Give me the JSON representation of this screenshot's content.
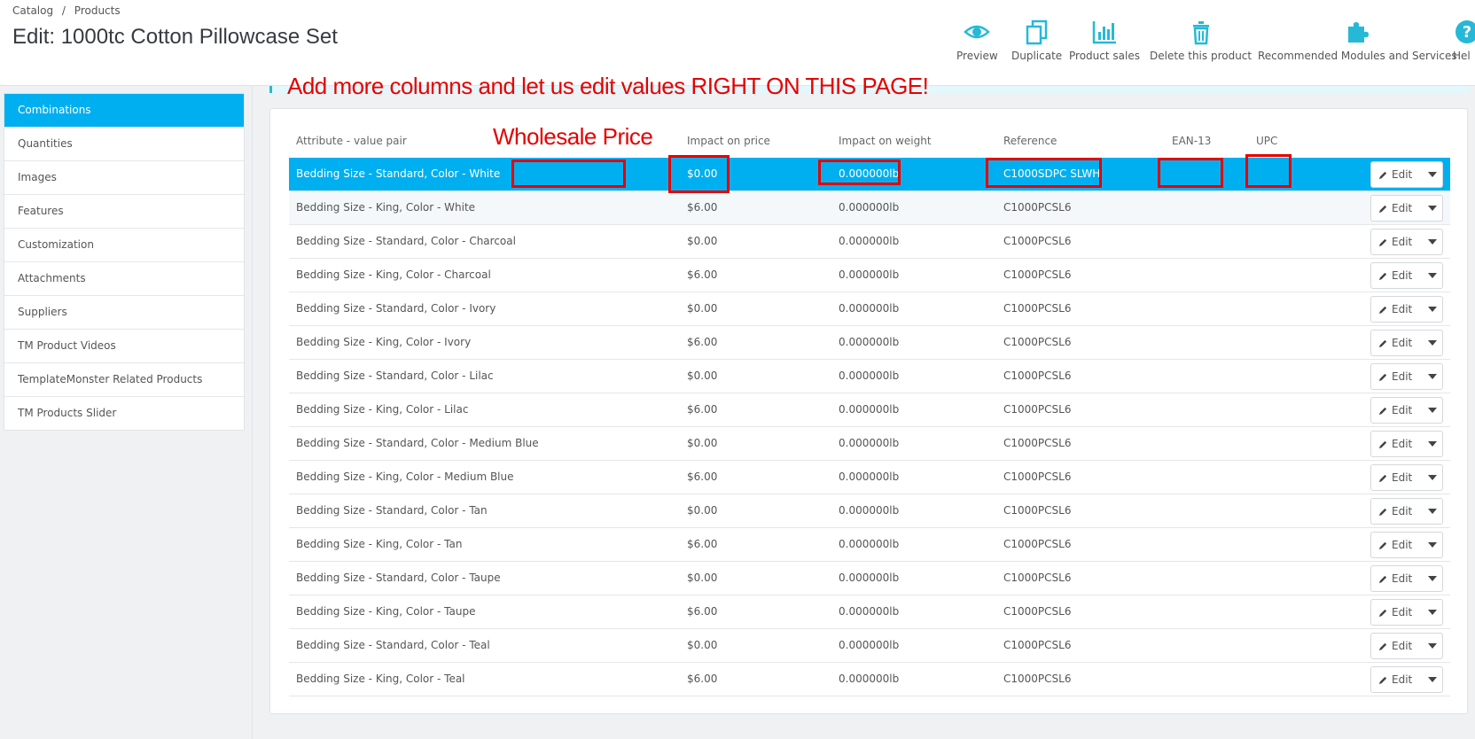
{
  "breadcrumb": [
    "Catalog",
    "/",
    "Products"
  ],
  "page_title": "Edit: 1000tc Cotton Pillowcase Set",
  "toolbar": {
    "preview": "Preview",
    "duplicate": "Duplicate",
    "product_sales": "Product sales",
    "delete": "Delete this product",
    "recommended": "Recommended Modules and Services",
    "help": "Hel"
  },
  "colors": {
    "accent": "#00aff0",
    "annotation": "#e60000"
  },
  "sidebar": {
    "items": [
      {
        "label": "Combinations"
      },
      {
        "label": "Quantities"
      },
      {
        "label": "Images"
      },
      {
        "label": "Features"
      },
      {
        "label": "Customization"
      },
      {
        "label": "Attachments"
      },
      {
        "label": "Suppliers"
      },
      {
        "label": "TM Product Videos"
      },
      {
        "label": "TemplateMonster Related Products"
      },
      {
        "label": "TM Products Slider"
      }
    ]
  },
  "annotations": {
    "top": "Add more columns and let us edit values RIGHT ON THIS PAGE!",
    "wholesale": "Wholesale Price"
  },
  "table": {
    "headers": {
      "attribute": "Attribute - value pair",
      "impact_price": "Impact on price",
      "impact_weight": "Impact on weight",
      "reference": "Reference",
      "ean": "EAN-13",
      "upc": "UPC"
    },
    "edit_label": "Edit",
    "rows": [
      {
        "attr": "Bedding Size - Standard, Color - White",
        "price": "$0.00",
        "weight": "0.000000lb",
        "ref": "C1000SDPC SLWH"
      },
      {
        "attr": "Bedding Size - King, Color - White",
        "price": "$6.00",
        "weight": "0.000000lb",
        "ref": "C1000PCSL6"
      },
      {
        "attr": "Bedding Size - Standard, Color - Charcoal",
        "price": "$0.00",
        "weight": "0.000000lb",
        "ref": "C1000PCSL6"
      },
      {
        "attr": "Bedding Size - King, Color - Charcoal",
        "price": "$6.00",
        "weight": "0.000000lb",
        "ref": "C1000PCSL6"
      },
      {
        "attr": "Bedding Size - Standard, Color - Ivory",
        "price": "$0.00",
        "weight": "0.000000lb",
        "ref": "C1000PCSL6"
      },
      {
        "attr": "Bedding Size - King, Color - Ivory",
        "price": "$6.00",
        "weight": "0.000000lb",
        "ref": "C1000PCSL6"
      },
      {
        "attr": "Bedding Size - Standard, Color - Lilac",
        "price": "$0.00",
        "weight": "0.000000lb",
        "ref": "C1000PCSL6"
      },
      {
        "attr": "Bedding Size - King, Color - Lilac",
        "price": "$6.00",
        "weight": "0.000000lb",
        "ref": "C1000PCSL6"
      },
      {
        "attr": "Bedding Size - Standard, Color - Medium Blue",
        "price": "$0.00",
        "weight": "0.000000lb",
        "ref": "C1000PCSL6"
      },
      {
        "attr": "Bedding Size - King, Color - Medium Blue",
        "price": "$6.00",
        "weight": "0.000000lb",
        "ref": "C1000PCSL6"
      },
      {
        "attr": "Bedding Size - Standard, Color - Tan",
        "price": "$0.00",
        "weight": "0.000000lb",
        "ref": "C1000PCSL6"
      },
      {
        "attr": "Bedding Size - King, Color - Tan",
        "price": "$6.00",
        "weight": "0.000000lb",
        "ref": "C1000PCSL6"
      },
      {
        "attr": "Bedding Size - Standard, Color - Taupe",
        "price": "$0.00",
        "weight": "0.000000lb",
        "ref": "C1000PCSL6"
      },
      {
        "attr": "Bedding Size - King, Color - Taupe",
        "price": "$6.00",
        "weight": "0.000000lb",
        "ref": "C1000PCSL6"
      },
      {
        "attr": "Bedding Size - Standard, Color - Teal",
        "price": "$0.00",
        "weight": "0.000000lb",
        "ref": "C1000PCSL6"
      },
      {
        "attr": "Bedding Size - King, Color - Teal",
        "price": "$6.00",
        "weight": "0.000000lb",
        "ref": "C1000PCSL6"
      }
    ]
  }
}
